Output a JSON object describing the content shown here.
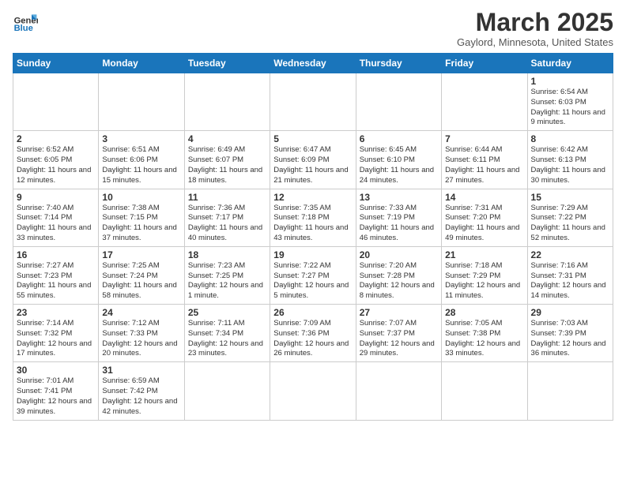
{
  "logo": {
    "text_general": "General",
    "text_blue": "Blue"
  },
  "title": "March 2025",
  "location": "Gaylord, Minnesota, United States",
  "days_of_week": [
    "Sunday",
    "Monday",
    "Tuesday",
    "Wednesday",
    "Thursday",
    "Friday",
    "Saturday"
  ],
  "weeks": [
    [
      {
        "num": "",
        "info": ""
      },
      {
        "num": "",
        "info": ""
      },
      {
        "num": "",
        "info": ""
      },
      {
        "num": "",
        "info": ""
      },
      {
        "num": "",
        "info": ""
      },
      {
        "num": "",
        "info": ""
      },
      {
        "num": "1",
        "info": "Sunrise: 6:54 AM\nSunset: 6:03 PM\nDaylight: 11 hours\nand 9 minutes."
      }
    ],
    [
      {
        "num": "2",
        "info": "Sunrise: 6:52 AM\nSunset: 6:05 PM\nDaylight: 11 hours\nand 12 minutes."
      },
      {
        "num": "3",
        "info": "Sunrise: 6:51 AM\nSunset: 6:06 PM\nDaylight: 11 hours\nand 15 minutes."
      },
      {
        "num": "4",
        "info": "Sunrise: 6:49 AM\nSunset: 6:07 PM\nDaylight: 11 hours\nand 18 minutes."
      },
      {
        "num": "5",
        "info": "Sunrise: 6:47 AM\nSunset: 6:09 PM\nDaylight: 11 hours\nand 21 minutes."
      },
      {
        "num": "6",
        "info": "Sunrise: 6:45 AM\nSunset: 6:10 PM\nDaylight: 11 hours\nand 24 minutes."
      },
      {
        "num": "7",
        "info": "Sunrise: 6:44 AM\nSunset: 6:11 PM\nDaylight: 11 hours\nand 27 minutes."
      },
      {
        "num": "8",
        "info": "Sunrise: 6:42 AM\nSunset: 6:13 PM\nDaylight: 11 hours\nand 30 minutes."
      }
    ],
    [
      {
        "num": "9",
        "info": "Sunrise: 7:40 AM\nSunset: 7:14 PM\nDaylight: 11 hours\nand 33 minutes."
      },
      {
        "num": "10",
        "info": "Sunrise: 7:38 AM\nSunset: 7:15 PM\nDaylight: 11 hours\nand 37 minutes."
      },
      {
        "num": "11",
        "info": "Sunrise: 7:36 AM\nSunset: 7:17 PM\nDaylight: 11 hours\nand 40 minutes."
      },
      {
        "num": "12",
        "info": "Sunrise: 7:35 AM\nSunset: 7:18 PM\nDaylight: 11 hours\nand 43 minutes."
      },
      {
        "num": "13",
        "info": "Sunrise: 7:33 AM\nSunset: 7:19 PM\nDaylight: 11 hours\nand 46 minutes."
      },
      {
        "num": "14",
        "info": "Sunrise: 7:31 AM\nSunset: 7:20 PM\nDaylight: 11 hours\nand 49 minutes."
      },
      {
        "num": "15",
        "info": "Sunrise: 7:29 AM\nSunset: 7:22 PM\nDaylight: 11 hours\nand 52 minutes."
      }
    ],
    [
      {
        "num": "16",
        "info": "Sunrise: 7:27 AM\nSunset: 7:23 PM\nDaylight: 11 hours\nand 55 minutes."
      },
      {
        "num": "17",
        "info": "Sunrise: 7:25 AM\nSunset: 7:24 PM\nDaylight: 11 hours\nand 58 minutes."
      },
      {
        "num": "18",
        "info": "Sunrise: 7:23 AM\nSunset: 7:25 PM\nDaylight: 12 hours\nand 1 minute."
      },
      {
        "num": "19",
        "info": "Sunrise: 7:22 AM\nSunset: 7:27 PM\nDaylight: 12 hours\nand 5 minutes."
      },
      {
        "num": "20",
        "info": "Sunrise: 7:20 AM\nSunset: 7:28 PM\nDaylight: 12 hours\nand 8 minutes."
      },
      {
        "num": "21",
        "info": "Sunrise: 7:18 AM\nSunset: 7:29 PM\nDaylight: 12 hours\nand 11 minutes."
      },
      {
        "num": "22",
        "info": "Sunrise: 7:16 AM\nSunset: 7:31 PM\nDaylight: 12 hours\nand 14 minutes."
      }
    ],
    [
      {
        "num": "23",
        "info": "Sunrise: 7:14 AM\nSunset: 7:32 PM\nDaylight: 12 hours\nand 17 minutes."
      },
      {
        "num": "24",
        "info": "Sunrise: 7:12 AM\nSunset: 7:33 PM\nDaylight: 12 hours\nand 20 minutes."
      },
      {
        "num": "25",
        "info": "Sunrise: 7:11 AM\nSunset: 7:34 PM\nDaylight: 12 hours\nand 23 minutes."
      },
      {
        "num": "26",
        "info": "Sunrise: 7:09 AM\nSunset: 7:36 PM\nDaylight: 12 hours\nand 26 minutes."
      },
      {
        "num": "27",
        "info": "Sunrise: 7:07 AM\nSunset: 7:37 PM\nDaylight: 12 hours\nand 29 minutes."
      },
      {
        "num": "28",
        "info": "Sunrise: 7:05 AM\nSunset: 7:38 PM\nDaylight: 12 hours\nand 33 minutes."
      },
      {
        "num": "29",
        "info": "Sunrise: 7:03 AM\nSunset: 7:39 PM\nDaylight: 12 hours\nand 36 minutes."
      }
    ],
    [
      {
        "num": "30",
        "info": "Sunrise: 7:01 AM\nSunset: 7:41 PM\nDaylight: 12 hours\nand 39 minutes."
      },
      {
        "num": "31",
        "info": "Sunrise: 6:59 AM\nSunset: 7:42 PM\nDaylight: 12 hours\nand 42 minutes."
      },
      {
        "num": "",
        "info": ""
      },
      {
        "num": "",
        "info": ""
      },
      {
        "num": "",
        "info": ""
      },
      {
        "num": "",
        "info": ""
      },
      {
        "num": "",
        "info": ""
      }
    ]
  ]
}
